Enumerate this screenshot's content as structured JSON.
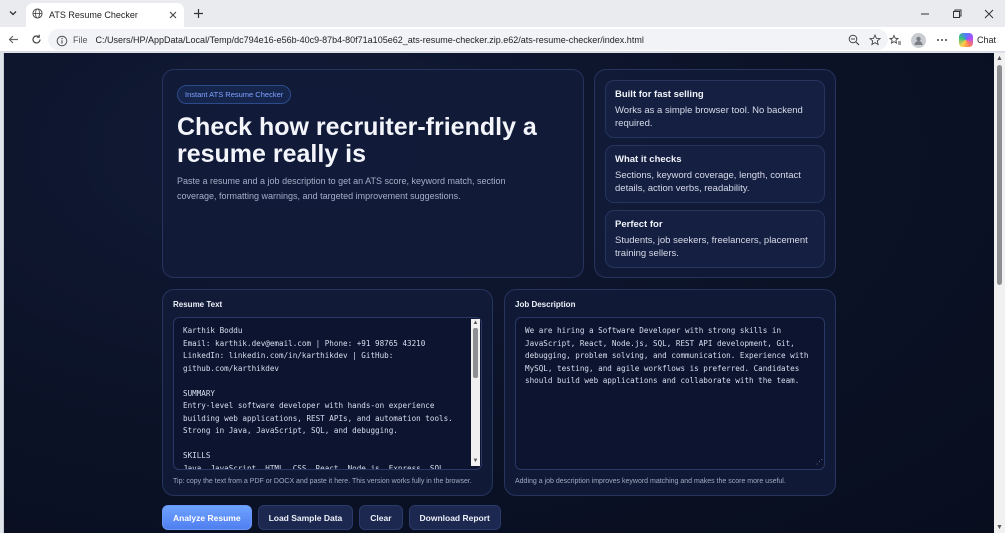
{
  "browser": {
    "tab_title": "ATS Resume Checker",
    "url_scheme": "File",
    "url": "C:/Users/HP/AppData/Local/Temp/dc794e16-e56b-40c9-87b4-80f71a105e62_ats-resume-checker.zip.e62/ats-resume-checker/index.html",
    "chat_label": "Chat"
  },
  "hero": {
    "badge": "Instant ATS Resume Checker",
    "title": "Check how recruiter-friendly a resume really is",
    "description": "Paste a resume and a job description to get an ATS score, keyword match, section coverage, formatting warnings, and targeted improvement suggestions."
  },
  "features": [
    {
      "title": "Built for fast selling",
      "desc": "Works as a simple browser tool. No backend required."
    },
    {
      "title": "What it checks",
      "desc": "Sections, keyword coverage, length, contact details, action verbs, readability."
    },
    {
      "title": "Perfect for",
      "desc": "Students, job seekers, freelancers, placement training sellers."
    }
  ],
  "resume": {
    "label": "Resume Text",
    "value": "Karthik Boddu\nEmail: karthik.dev@email.com | Phone: +91 98765 43210\nLinkedIn: linkedin.com/in/karthikdev | GitHub:\ngithub.com/karthikdev\n\nSUMMARY\nEntry-level software developer with hands-on experience\nbuilding web applications, REST APIs, and automation tools.\nStrong in Java, JavaScript, SQL, and debugging.\n\nSKILLS\nJava, JavaScript, HTML, CSS, React, Node.js, Express, SQL,",
    "hint": "Tip: copy the text from a PDF or DOCX and paste it here. This version works fully in the browser."
  },
  "job": {
    "label": "Job Description",
    "value": "We are hiring a Software Developer with strong skills in\nJavaScript, React, Node.js, SQL, REST API development, Git,\ndebugging, problem solving, and communication. Experience with\nMySQL, testing, and agile workflows is preferred. Candidates\nshould build web applications and collaborate with the team.",
    "hint": "Adding a job description improves keyword matching and makes the score more useful."
  },
  "actions": {
    "analyze": "Analyze Resume",
    "load_sample": "Load Sample Data",
    "clear": "Clear",
    "download": "Download Report"
  }
}
